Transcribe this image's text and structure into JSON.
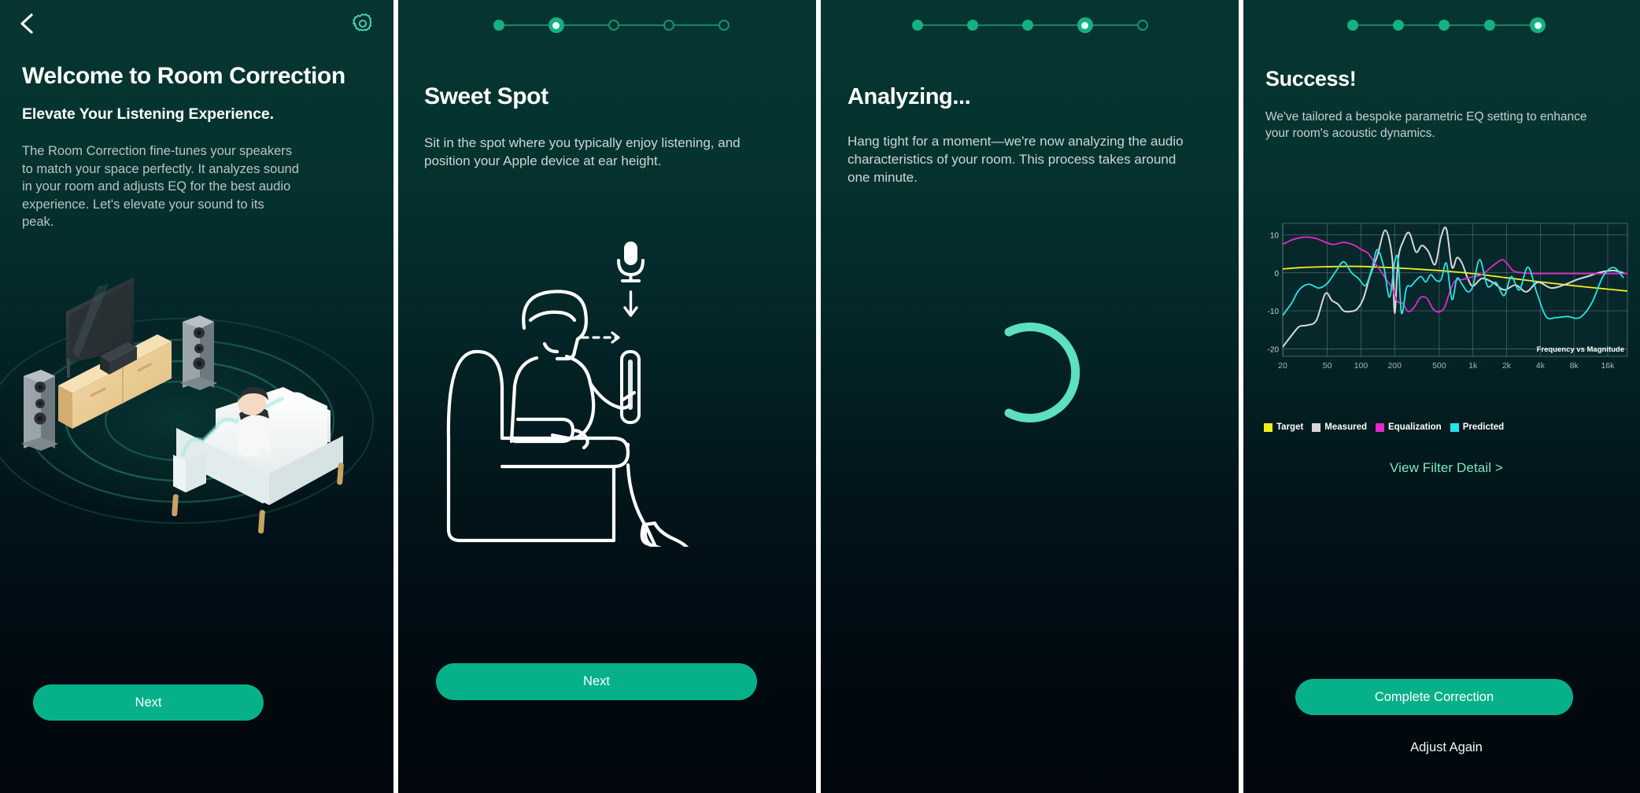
{
  "theme": {
    "accent": "#06b189",
    "accent_light": "#5ce0c0",
    "bg_top": "#063431",
    "bg_bottom": "#01070c",
    "text_primary": "#ffffff",
    "text_secondary": "#b9c4c4",
    "divider": "#ffffff"
  },
  "panels": [
    {
      "id": "welcome",
      "topbar": {
        "back_label": "Back",
        "settings_label": "Settings"
      },
      "title": "Welcome to Room Correction",
      "subtitle": "Elevate Your Listening Experience.",
      "body": "The Room Correction fine-tunes your speakers to match your space perfectly. It analyzes sound in your room and adjusts EQ for the best audio experience. Let's elevate your sound to its peak.",
      "illustration": "isometric-living-room-with-speakers",
      "cta": "Next"
    },
    {
      "id": "sweet-spot",
      "steps": {
        "total": 5,
        "current": 2,
        "states": [
          "done",
          "active",
          "todo",
          "todo",
          "todo"
        ]
      },
      "title": "Sweet Spot",
      "body": "Sit in the spot where you typically enjoy listening, and position your Apple device at ear height.",
      "illustration": "person-seated-holding-phone-at-ear-height",
      "cta": "Next"
    },
    {
      "id": "analyzing",
      "steps": {
        "total": 5,
        "current": 4,
        "states": [
          "done",
          "done",
          "done",
          "active",
          "todo"
        ]
      },
      "title": "Analyzing...",
      "body": "Hang tight for a moment—we're now analyzing the audio characteristics of your room. This process takes around one minute.",
      "illustration": "loading-spinner-arc"
    },
    {
      "id": "success",
      "steps": {
        "total": 5,
        "current": 5,
        "states": [
          "done",
          "done",
          "done",
          "done",
          "active"
        ]
      },
      "title": "Success!",
      "body": "We've tailored a bespoke parametric EQ setting to enhance your room's acoustic dynamics.",
      "filter_link": "View Filter Detail >",
      "cta": "Complete Correction",
      "secondary": "Adjust Again"
    }
  ],
  "chart_data": {
    "type": "line",
    "title": "Frequency vs Magnitude",
    "xlabel": "",
    "ylabel": "",
    "x_scale": "log",
    "xlim": [
      20,
      24000
    ],
    "ylim": [
      -22,
      13
    ],
    "yticks": [
      10,
      0,
      -10,
      -20
    ],
    "xticks": [
      20,
      50,
      100,
      200,
      500,
      1000,
      2000,
      4000,
      8000,
      16000
    ],
    "xtick_labels": [
      "20",
      "50",
      "100",
      "200",
      "500",
      "1k",
      "2k",
      "4k",
      "8k",
      "16k"
    ],
    "grid": true,
    "legend_position": "below",
    "legend": [
      "Target",
      "Measured",
      "Equalization",
      "Predicted"
    ],
    "colors": {
      "Target": "#f2ee1c",
      "Measured": "#d8d8d8",
      "Equalization": "#e628cd",
      "Predicted": "#25e6e6"
    },
    "series": [
      {
        "name": "Target",
        "color": "#f2ee1c",
        "x": [
          20,
          30,
          50,
          80,
          120,
          200,
          350,
          600,
          1000,
          2000,
          4000,
          8000,
          16000,
          24000
        ],
        "values": [
          1.0,
          1.4,
          1.6,
          1.7,
          1.6,
          1.3,
          0.9,
          0.4,
          -0.2,
          -1.3,
          -2.4,
          -3.4,
          -4.3,
          -4.8
        ]
      },
      {
        "name": "Measured",
        "color": "#d8d8d8",
        "x": [
          20,
          24,
          28,
          33,
          40,
          48,
          55,
          62,
          70,
          80,
          92,
          105,
          120,
          140,
          165,
          190,
          200,
          215,
          240,
          270,
          310,
          350,
          400,
          460,
          520,
          580,
          650,
          720,
          800,
          900,
          1000,
          1200,
          1500,
          1900,
          2400,
          3000,
          3800,
          5000,
          6500,
          8500,
          11000,
          14000,
          18000,
          22000
        ],
        "values": [
          -19.5,
          -16.5,
          -14.2,
          -13.8,
          -12.5,
          -5.5,
          -7.3,
          -8.2,
          -10.0,
          -10.2,
          -9.6,
          -6.8,
          -1.0,
          4.5,
          11.2,
          4.0,
          -10.6,
          3.5,
          8.5,
          10.5,
          5.5,
          7.2,
          5.6,
          2.2,
          9.5,
          11.5,
          1.5,
          4.0,
          2.5,
          -1.5,
          -3.5,
          -1.5,
          -2.5,
          -4.5,
          -3.2,
          -5.0,
          -2.5,
          -4.0,
          -3.2,
          -1.8,
          -0.8,
          0.2,
          0.6,
          0.0
        ]
      },
      {
        "name": "Equalization",
        "color": "#e628cd",
        "x": [
          20,
          25,
          32,
          40,
          55,
          70,
          85,
          100,
          115,
          130,
          150,
          170,
          190,
          210,
          235,
          265,
          300,
          340,
          390,
          440,
          500,
          560,
          630,
          700,
          790,
          890,
          1000,
          1200,
          1500,
          1800,
          2000,
          2300,
          2800,
          3500,
          5000,
          8000,
          14000,
          24000
        ],
        "values": [
          7.5,
          8.8,
          9.4,
          9.0,
          7.5,
          8.0,
          7.4,
          6.2,
          5.2,
          3.0,
          0.5,
          -2.0,
          -4.0,
          -7.5,
          -8.0,
          -10.2,
          -9.0,
          -6.5,
          -6.8,
          -9.5,
          -10.3,
          -9.0,
          -4.5,
          -2.0,
          -1.8,
          -1.5,
          -1.0,
          -0.5,
          1.8,
          3.4,
          2.6,
          0.5,
          0.0,
          -0.2,
          -0.2,
          -0.2,
          -0.2,
          -0.2
        ]
      },
      {
        "name": "Predicted",
        "color": "#25e6e6",
        "x": [
          20,
          24,
          28,
          34,
          42,
          50,
          60,
          70,
          82,
          95,
          110,
          125,
          140,
          160,
          180,
          200,
          215,
          230,
          255,
          280,
          310,
          345,
          380,
          420,
          470,
          520,
          580,
          650,
          720,
          800,
          900,
          1000,
          1150,
          1350,
          1600,
          1900,
          2200,
          2600,
          3100,
          3700,
          4500,
          5500,
          7000,
          9000,
          11500,
          14500,
          18000,
          22000
        ],
        "values": [
          -11.2,
          -8.0,
          -4.5,
          -3.0,
          -4.0,
          -2.8,
          0.5,
          2.9,
          0.1,
          -1.5,
          -3.3,
          1.0,
          6.1,
          1.5,
          -6.4,
          2.8,
          3.4,
          -10.6,
          -4.0,
          -3.5,
          -2.0,
          -1.0,
          -2.4,
          -0.5,
          -2.0,
          -1.8,
          2.5,
          -7.0,
          -1.5,
          -3.0,
          -5.0,
          -3.5,
          3.5,
          -3.5,
          -2.5,
          -6.0,
          -1.0,
          -4.5,
          1.5,
          -5.0,
          -11.5,
          -11.8,
          -11.5,
          -11.8,
          -8.0,
          -1.0,
          1.4,
          -1.2
        ]
      }
    ]
  }
}
